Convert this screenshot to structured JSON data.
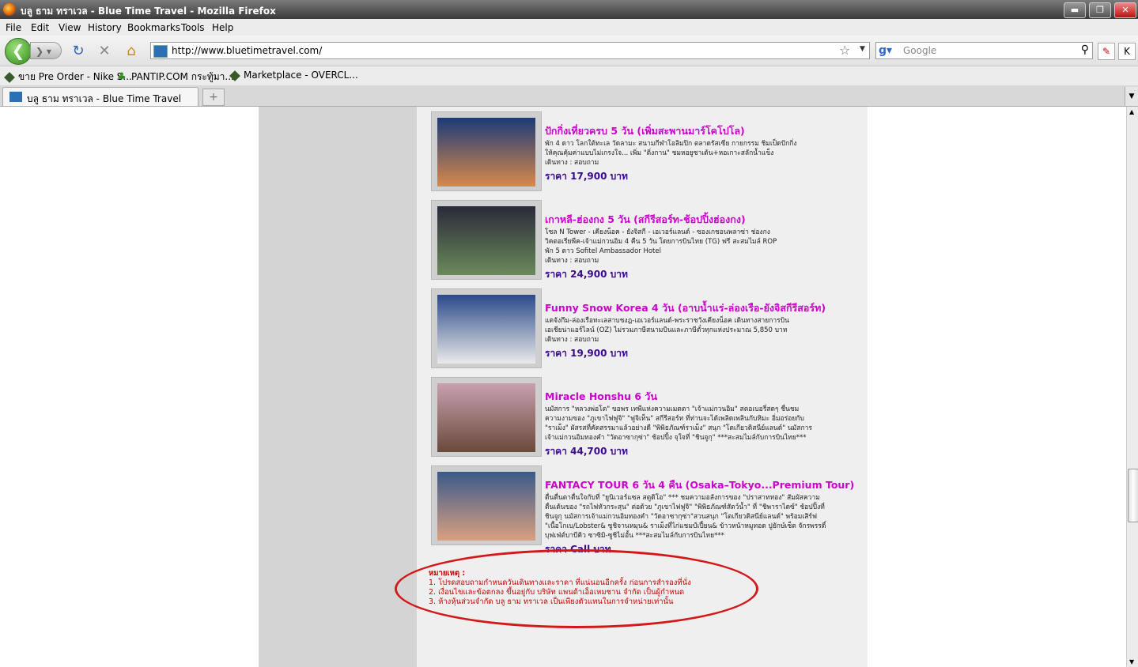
{
  "window": {
    "title": "บลู ธาม ทราเวล - Blue Time Travel - Mozilla Firefox",
    "minimize": "▬",
    "restore": "❐",
    "close": "✕"
  },
  "menu": {
    "file": "File",
    "edit": "Edit",
    "view": "View",
    "history": "History",
    "bookmarks": "Bookmarks",
    "tools": "Tools",
    "help": "Help"
  },
  "nav": {
    "url": "http://www.bluetimetravel.com/",
    "search_placeholder": "Google"
  },
  "bookmarks": [
    {
      "label": "ขาย Pre Order - Nike S..."
    },
    {
      "label": "PANTIP.COM กระทู้มา..."
    },
    {
      "label": "Marketplace - OVERCL..."
    }
  ],
  "tab": {
    "label": "บลู ธาม ทราเวล - Blue Time Travel",
    "new_tab": "+"
  },
  "tours": [
    {
      "title": "ปักกิ่งเที่ยวครบ 5 วัน (เพิ่มสะพานมาร์โคโปโล)",
      "desc": [
        "พัก 4 ดาว โลกใต้ทะเล วัดลามะ สนามกีฬาโอลิมปิก ตลาดรัสเซีย กายกรรม ชิมเป็ดปักกิ่ง",
        "ให้คุณคุ้มค่าแบบไม่เกรงใจ... เพิ่ม \"ติ่งกาน\" ชมหอยูซาเด้น+หอเกาะสลักน้ำแข็ง",
        "เดินทาง : สอบถาม"
      ],
      "price": "ราคา 17,900 บาท",
      "colors": [
        "#1b3a78",
        "#d8894a"
      ]
    },
    {
      "title": "เกาหลี-ฮ่องกง 5 วัน (สกีรีสอร์ท-ช้อปปิ้งฮ่องกง)",
      "desc": [
        "โซล N Tower - เคียงน็อค - ยังจิสกี - เอเวอร์แลนด์ - ซองเกชอนพลาซ่า ช่องกง",
        "วิคตอเรียพีค-เจ้าแม่กวนอิม 4 คืน 5 วัน โดยการบินไทย (TG) ฟรี สะสมไมล์ ROP",
        "พัก 5 ดาว Sofitel Ambassador Hotel",
        "เดินทาง : สอบถาม"
      ],
      "price": "ราคา 24,900 บาท",
      "colors": [
        "#2a2a3a",
        "#6a8a5a"
      ]
    },
    {
      "title": "Funny Snow Korea 4 วัน (อาบน้ำแร่-ล่องเรือ-ยังจิสกีรีสอร์ท)",
      "desc": [
        "แดจังกึม-ล่องเรือทะเลสาบชงฎ-เอเวอร์แลนด์-พระราชวังเคียงน็อค เดินทางสายการบิน",
        "เอเชียน่าแอร์ไลน์ (OZ) ไม่รวมภาษีสนามบินและภาษีตั๋วทุกแห่งประมาณ 5,850 บาท",
        "เดินทาง : สอบถาม"
      ],
      "price": "ราคา 19,900 บาท",
      "colors": [
        "#2a4a8a",
        "#eaeaea"
      ]
    },
    {
      "title": "Miracle Honshu 6 วัน",
      "desc": [
        "นมัสการ \"หลวงพ่อโต\" ขอพร เทพีแห่งความเมตตา \"เจ้าแม่กวนอิม\" สตอเบอรี่สดๆ ชื่นชม",
        "ความงามของ \"ภูเขาไฟฟูจิ\" \"ฟูจิเท็น\" สกีรีสอร์ท ที่ท่านจะได้เพลิดเพลินกับหิมะ อิ่มอร่อยกับ",
        "\"ราเม็ง\" ผัสรสที่คัดสรรมาแล้วอย่างดี \"พิพิธภัณฑ์ราเม็ง\" สนุก \"โตเกียวดิสนีย์แลนด์\" นมัสการ",
        "เจ้าแม่กวนอิมทองคำ \"วัดอาซากุซ่า\" ช้อปปิ้ง จุใจที่ \"ชินจูกุ\" ***สะสมไมล์กับการบินไทย***"
      ],
      "price": "ราคา 44,700 บาท",
      "colors": [
        "#c9a0b0",
        "#6a4a3a"
      ]
    },
    {
      "title": "FANTACY TOUR 6 วัน 4 คืน (Osaka–Tokyo...Premium Tour)",
      "desc": [
        "ตื่นตื่นตาตื่นใจกับที่ \"ยูนิเวอร์แซล สตูดิโอ\" *** ชมความอลังการของ \"ปราสาททอง\" สัมผัสความ",
        "ตื่นเต้นของ \"รถไฟหัวกระสุน\" ต่อด้วย \"ภูเขาไฟฟูจิ\" \"พิพิธภัณฑ์สัตว์น้ำ\" ที่ \"ชิพาราไดซ์\" ช้อปปิ้งที่",
        "ชินจูกุ นมัสการเจ้าแม่กวนอิมทองคำ \"วัดอาซากุซ่า\"สวนสนุก \"โตเกียวดิสนีย์แลนด์\"  พร้อมเสิร์ฟ",
        "\"เนื้อโกเบ/Lobster& ซูชิจานหมุน& ราเม็งที่ไก่แชมป์เปี้ยน& ข้าวหน้าหมูทอด ปูยักษ์เซ็ต จักรพรรดิ์",
        "บุฟเฟ่ต์บาบีคิว ซาซิมิ-ซูชิไม่อั้น ***สะสมไมล์กับการบินไทย***"
      ],
      "price": "ราคา Call บาท",
      "colors": [
        "#3a5a8a",
        "#d9a080"
      ]
    }
  ],
  "note": {
    "heading": "หมายเหตุ :",
    "lines": [
      "1. โปรดสอบถามกำหนดวันเดินทางและราคา ที่แน่นอนอีกครั้ง ก่อนการสำรองที่นั่ง",
      "2. เงื่อนไขและข้อตกลง ขึ้นอยู่กับ  บริษัท แพนด้าเอ็อเหมชาน จำกัด เป็นผู้กำหนด",
      "3. ห้างหุ้นส่วนจำกัด บลู ธาม ทราเวล เป็นเพียงตัวแทนในการจำหน่ายเท่านั้น"
    ]
  },
  "colors": {
    "tour_title": "#cc00cc",
    "price": "#3a0c8c",
    "note": "#cc0000"
  }
}
